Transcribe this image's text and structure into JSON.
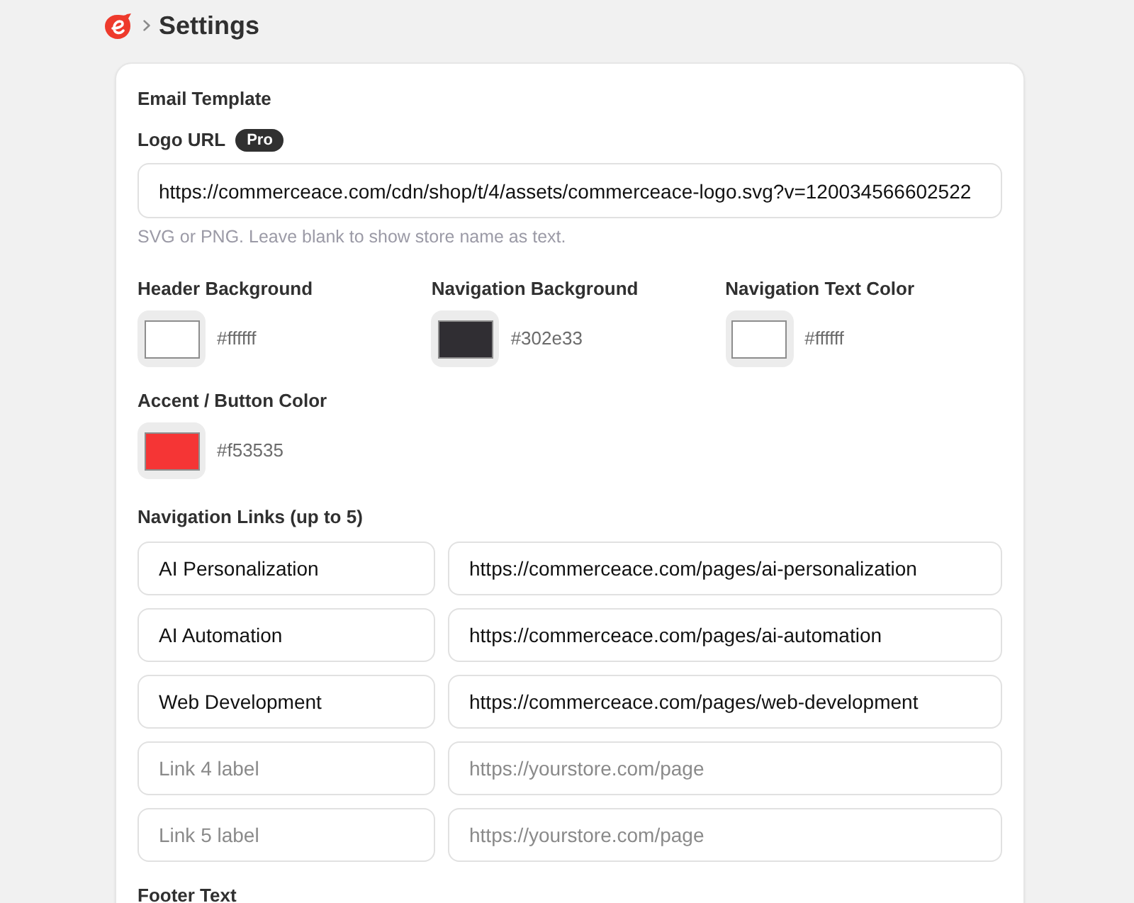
{
  "header": {
    "title": "Settings"
  },
  "email_template": {
    "title": "Email Template",
    "logo_url": {
      "label": "Logo URL",
      "badge": "Pro",
      "value": "https://commerceace.com/cdn/shop/t/4/assets/commerceace-logo.svg?v=120034566602522",
      "help": "SVG or PNG. Leave blank to show store name as text."
    },
    "colors": [
      {
        "label": "Header Background",
        "color": "#ffffff",
        "value": "#ffffff"
      },
      {
        "label": "Navigation Background",
        "color": "#302e33",
        "value": "#302e33"
      },
      {
        "label": "Navigation Text Color",
        "color": "#ffffff",
        "value": "#ffffff"
      },
      {
        "label": "Accent / Button Color",
        "color": "#f53535",
        "value": "#f53535"
      }
    ],
    "navigation_links": {
      "label": "Navigation Links (up to 5)",
      "links": [
        {
          "label": {
            "value": "AI Personalization"
          },
          "url": {
            "value": "https://commerceace.com/pages/ai-personalization"
          }
        },
        {
          "label": {
            "value": "AI Automation"
          },
          "url": {
            "value": "https://commerceace.com/pages/ai-automation"
          }
        },
        {
          "label": {
            "value": "Web Development"
          },
          "url": {
            "value": "https://commerceace.com/pages/web-development"
          }
        },
        {
          "label": {
            "placeholder": "Link 4 label"
          },
          "url": {
            "placeholder": "https://yourstore.com/page"
          }
        },
        {
          "label": {
            "placeholder": "Link 5 label"
          },
          "url": {
            "placeholder": "https://yourstore.com/page"
          }
        }
      ]
    },
    "footer_text": {
      "label": "Footer Text"
    }
  }
}
